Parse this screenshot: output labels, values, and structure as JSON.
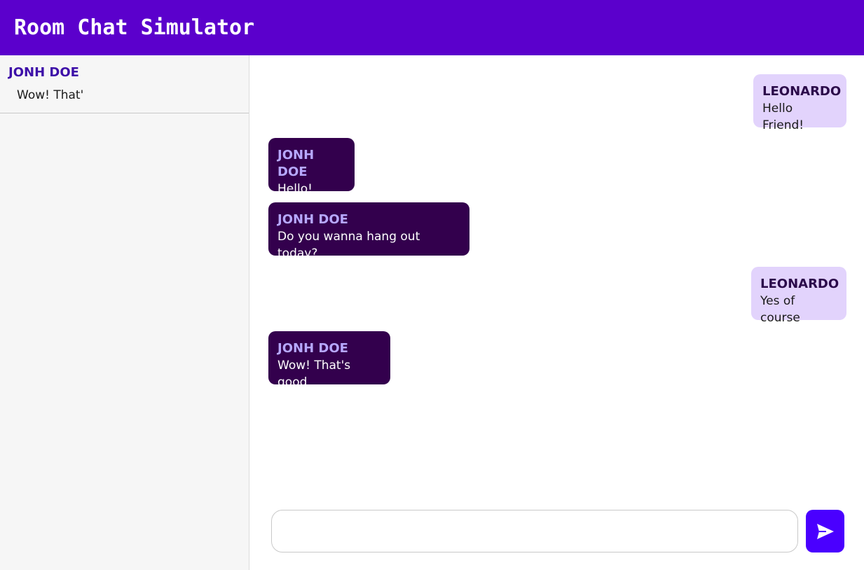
{
  "header": {
    "title": "Room Chat Simulator"
  },
  "sidebar": {
    "contacts": [
      {
        "name": "JONH DOE",
        "preview": "Wow! That'"
      }
    ]
  },
  "chat": {
    "messages": [
      {
        "sender": "LEONARDO",
        "text": "Hello Friend!",
        "side": "right"
      },
      {
        "sender": "JONH DOE",
        "text": "Hello!",
        "side": "left"
      },
      {
        "sender": "JONH DOE",
        "text": "Do you wanna hang out today?",
        "side": "left"
      },
      {
        "sender": "LEONARDO",
        "text": "Yes of course",
        "side": "right"
      },
      {
        "sender": "JONH DOE",
        "text": "Wow! That's good",
        "side": "left"
      }
    ]
  },
  "composer": {
    "value": "",
    "placeholder": "",
    "send_icon": "send-icon"
  },
  "colors": {
    "header": "#5b00cc",
    "sent_bubble": "#e2d3fc",
    "received_bubble": "#33004d",
    "send_button": "#4a00ff"
  }
}
